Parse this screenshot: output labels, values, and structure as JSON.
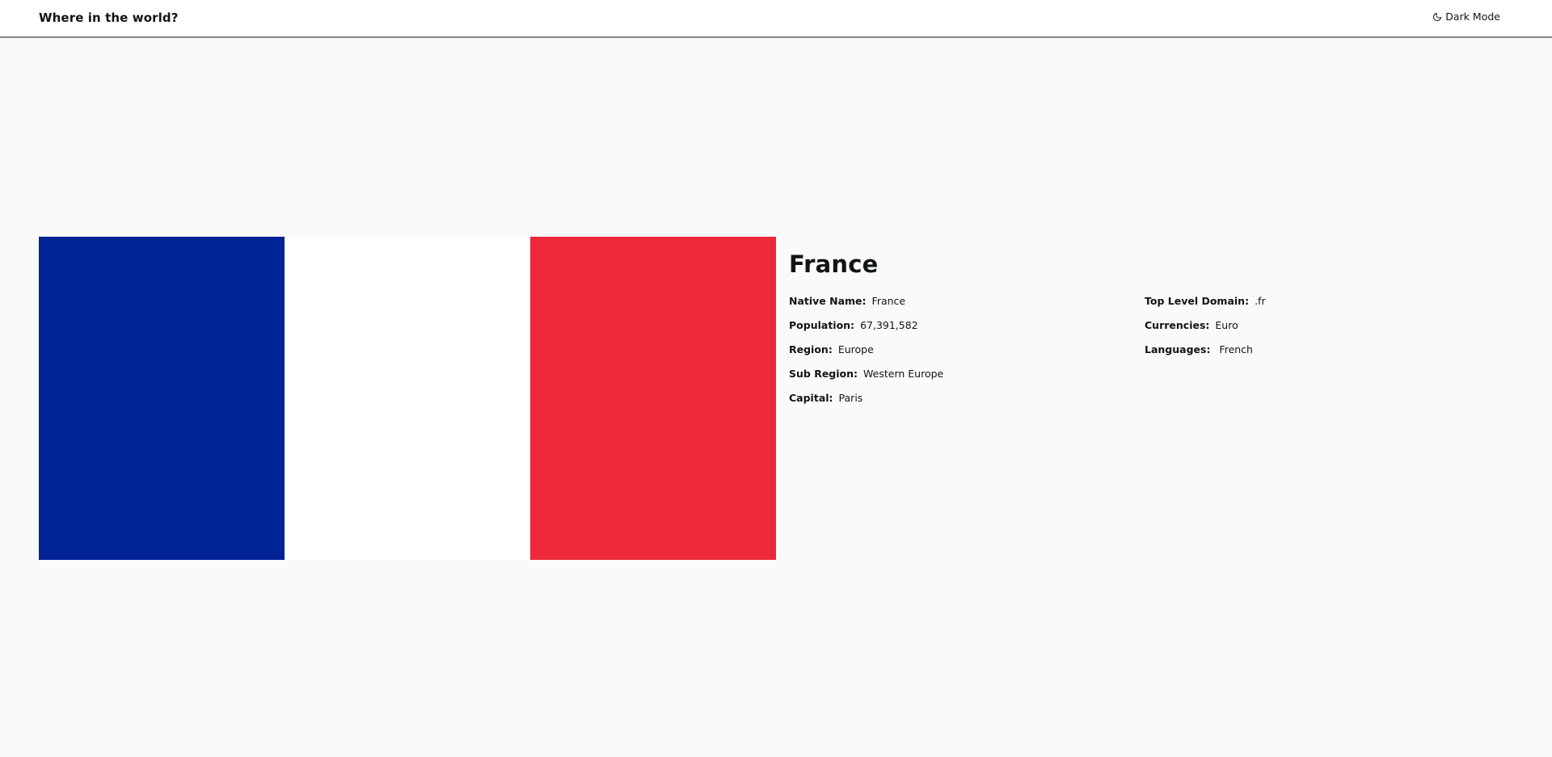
{
  "header": {
    "title": "Where in the world?",
    "mode_toggle_label": "Dark Mode",
    "mode_toggle_icon": "moon-icon"
  },
  "flag": {
    "description_colors": [
      "#002395",
      "#ffffff",
      "#ed2939"
    ]
  },
  "country": {
    "name": "France",
    "left_fields": [
      {
        "label": "Native Name:",
        "value": "France"
      },
      {
        "label": "Population:",
        "value": "67,391,582"
      },
      {
        "label": "Region:",
        "value": "Europe"
      },
      {
        "label": "Sub Region:",
        "value": "Western Europe"
      },
      {
        "label": "Capital:",
        "value": "Paris"
      }
    ],
    "right_fields": [
      {
        "label": "Top Level Domain:",
        "value": ".fr"
      },
      {
        "label": "Currencies:",
        "value": "Euro"
      },
      {
        "label": "Languages:",
        "value": " French"
      }
    ]
  }
}
